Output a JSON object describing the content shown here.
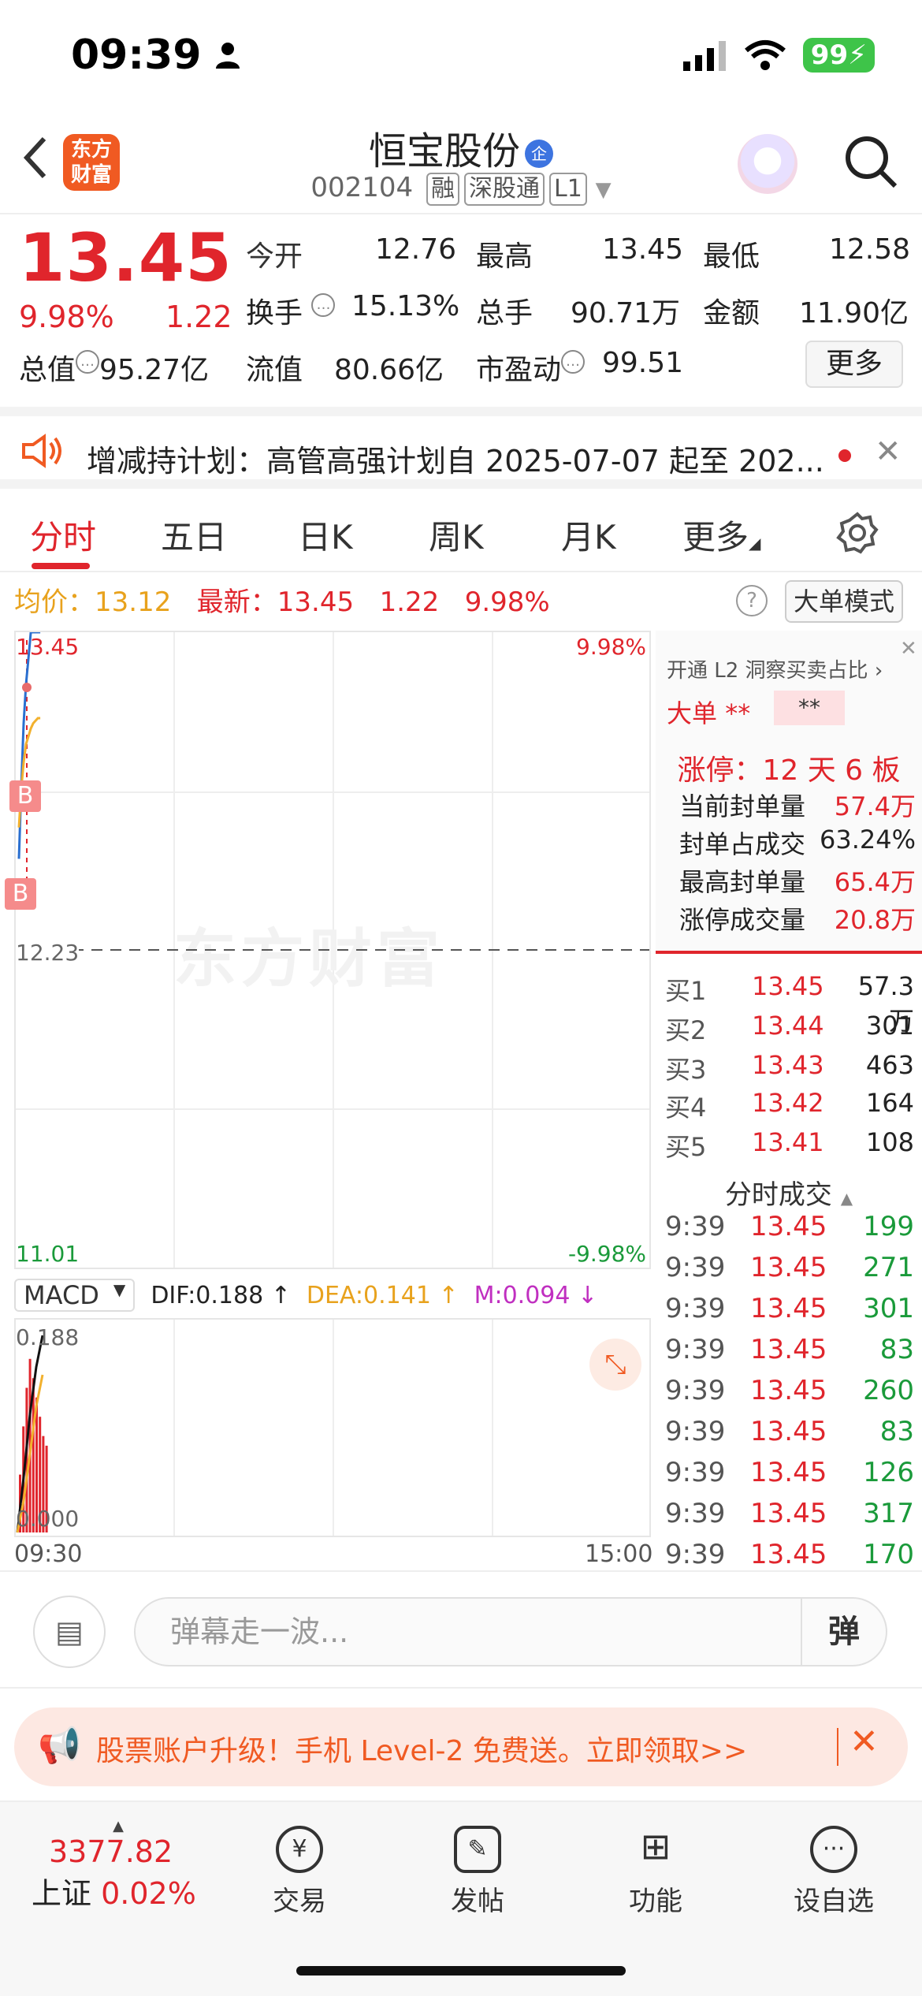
{
  "status": {
    "time": "09:39",
    "battery": "99"
  },
  "header": {
    "logo": "东方\n财富",
    "title": "恒宝股份",
    "title_badge": "企",
    "code": "002104",
    "tags": [
      "融",
      "深股通",
      "L1"
    ]
  },
  "quote": {
    "price": "13.45",
    "pct": "9.98%",
    "change": "1.22",
    "rows": [
      [
        {
          "label": "今开",
          "value": "12.76"
        },
        {
          "label": "最高",
          "value": "13.45"
        },
        {
          "label": "最低",
          "value": "12.58"
        }
      ],
      [
        {
          "label": "换手",
          "value": "15.13%"
        },
        {
          "label": "总手",
          "value": "90.71万"
        },
        {
          "label": "金额",
          "value": "11.90亿"
        }
      ],
      [
        {
          "label": "总值",
          "value": "95.27亿"
        },
        {
          "label": "流值",
          "value": "80.66亿"
        },
        {
          "label": "市盈动",
          "value": "99.51"
        }
      ]
    ],
    "more": "更多"
  },
  "notice": {
    "text": "增减持计划：高管高强计划自 2025-07-07 起至 202..."
  },
  "tabs": [
    "分时",
    "五日",
    "日K",
    "周K",
    "月K",
    "更多"
  ],
  "chart_head": {
    "avg_label": "均价：",
    "avg_value": "13.12",
    "latest_label": "最新：",
    "latest_value": "13.45",
    "latest_change": "1.22",
    "latest_pct": "9.98%",
    "mode": "大单模式"
  },
  "chart": {
    "y_top": "13.45",
    "y_mid": "12.23",
    "y_bottom": "11.01",
    "pct_top": "9.98%",
    "pct_bottom": "-9.98%",
    "watermark": "东方财富",
    "marker": "B"
  },
  "chart_data": {
    "type": "line",
    "x": [
      "09:30",
      "09:31",
      "09:32",
      "09:33",
      "09:34",
      "09:35",
      "09:36",
      "09:37",
      "09:38",
      "09:39"
    ],
    "series": [
      {
        "name": "price",
        "values": [
          12.58,
          12.86,
          13.1,
          13.25,
          13.35,
          13.45,
          13.45,
          13.45,
          13.45,
          13.45
        ]
      },
      {
        "name": "avg",
        "values": [
          12.7,
          12.85,
          12.95,
          13.02,
          13.05,
          13.08,
          13.1,
          13.11,
          13.12,
          13.12
        ]
      }
    ],
    "ylim": [
      11.01,
      13.45
    ],
    "baseline": 12.23,
    "x_start": "09:30",
    "x_end": "15:00"
  },
  "macd": {
    "select": "MACD",
    "dif": "DIF:0.188 ↑",
    "dea": "DEA:0.141 ↑",
    "m": "M:0.094 ↓",
    "top": "0.188",
    "bottom": "0.000",
    "bars": [
      0.06,
      0.11,
      0.15,
      0.18,
      0.16,
      0.14,
      0.12,
      0.1,
      0.09
    ]
  },
  "time_axis": {
    "start": "09:30",
    "end": "15:00"
  },
  "right_panel": {
    "l2": "开通 L2 洞察买卖占比 ›",
    "big_order": "大单",
    "stars_red": "**",
    "stars": "**",
    "zt_title": "涨停：12 天 6 板",
    "zt_rows": [
      {
        "label": "当前封单量",
        "value": "57.4万",
        "red": true
      },
      {
        "label": "封单占成交",
        "value": "63.24%",
        "red": false
      },
      {
        "label": "最高封单量",
        "value": "65.4万",
        "red": true
      },
      {
        "label": "涨停成交量",
        "value": "20.8万",
        "red": true
      }
    ],
    "orderbook": [
      {
        "label": "买1",
        "price": "13.45",
        "vol": "57.3万"
      },
      {
        "label": "买2",
        "price": "13.44",
        "vol": "301"
      },
      {
        "label": "买3",
        "price": "13.43",
        "vol": "463"
      },
      {
        "label": "买4",
        "price": "13.42",
        "vol": "164"
      },
      {
        "label": "买5",
        "price": "13.41",
        "vol": "108"
      }
    ],
    "trades_title": "分时成交",
    "trades": [
      {
        "t": "9:39",
        "p": "13.45",
        "v": "199"
      },
      {
        "t": "9:39",
        "p": "13.45",
        "v": "271"
      },
      {
        "t": "9:39",
        "p": "13.45",
        "v": "301"
      },
      {
        "t": "9:39",
        "p": "13.45",
        "v": "83"
      },
      {
        "t": "9:39",
        "p": "13.45",
        "v": "260"
      },
      {
        "t": "9:39",
        "p": "13.45",
        "v": "83"
      },
      {
        "t": "9:39",
        "p": "13.45",
        "v": "126"
      },
      {
        "t": "9:39",
        "p": "13.45",
        "v": "317"
      },
      {
        "t": "9:39",
        "p": "13.45",
        "v": "170"
      }
    ]
  },
  "barrage": {
    "placeholder": "弹幕走一波...",
    "button": "弹"
  },
  "promo": {
    "text": "股票账户升级！手机 Level-2 免费送。立即领取>>"
  },
  "bottom_nav": {
    "index_value": "3377.82",
    "index_name": "上证",
    "index_pct": "0.02%",
    "items": [
      "交易",
      "发帖",
      "功能",
      "设自选"
    ]
  }
}
